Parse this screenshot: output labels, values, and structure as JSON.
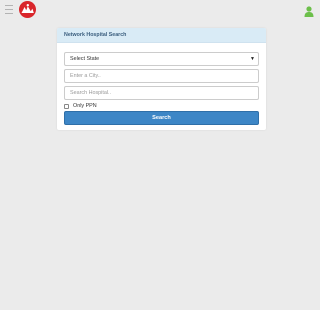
{
  "header": {
    "menu_icon": "hamburger-menu-icon",
    "logo": "red-circle-logo",
    "user_icon": "user-icon",
    "user_icon_color": "#6cbf4a",
    "logo_color": "#d9262b"
  },
  "form": {
    "title": "Network Hospital Search",
    "state_select": "Select State",
    "city_placeholder": "Enter a City..",
    "hospital_placeholder": "Search Hospital..",
    "ppn_label": "Only PPN",
    "ppn_checked": false,
    "search_button": "Search",
    "accent_color": "#3d86c6"
  }
}
